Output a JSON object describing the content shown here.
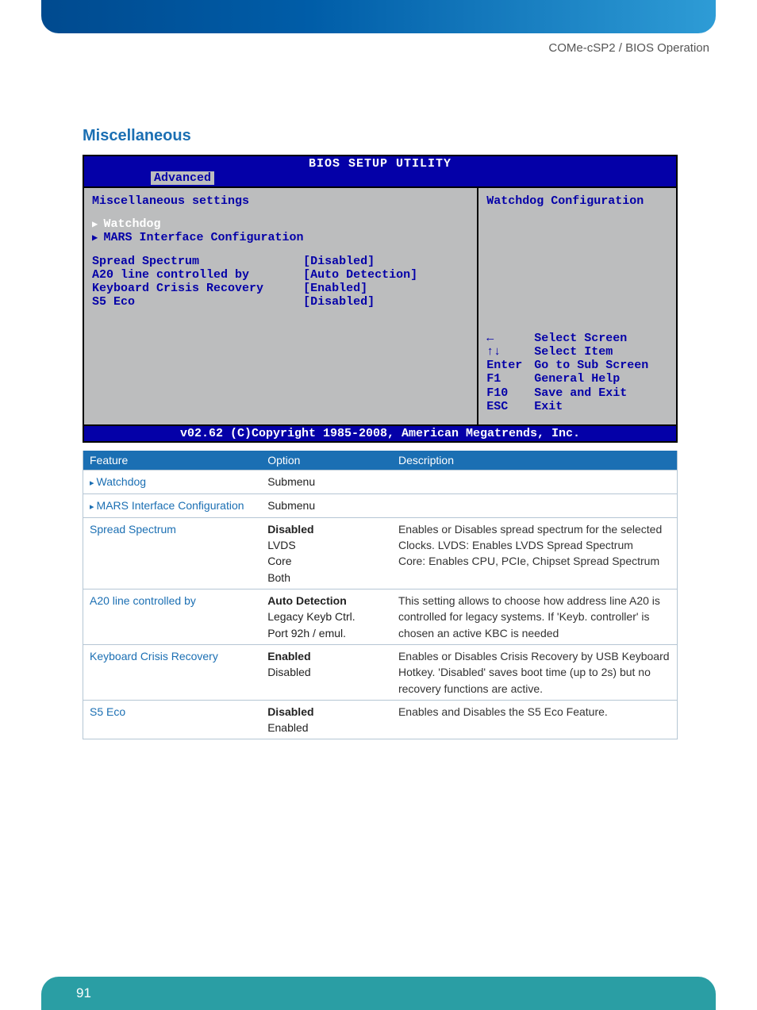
{
  "breadcrumb": "COMe-cSP2 / BIOS Operation",
  "section_title": "Miscellaneous",
  "bios": {
    "title": "BIOS SETUP UTILITY",
    "tab": "Advanced",
    "left_heading": "Miscellaneous settings",
    "submenus": [
      {
        "label": "Watchdog",
        "selected": true
      },
      {
        "label": "MARS Interface Configuration",
        "selected": false
      }
    ],
    "settings": [
      {
        "label": "Spread Spectrum",
        "value": "[Disabled]"
      },
      {
        "label": "A20 line controlled by",
        "value": "[Auto Detection]"
      },
      {
        "label": "Keyboard Crisis Recovery",
        "value": "[Enabled]"
      },
      {
        "label": "S5 Eco",
        "value": "[Disabled]"
      }
    ],
    "right_heading": "Watchdog Configuration",
    "help": [
      {
        "key": "←",
        "action": "Select Screen"
      },
      {
        "key": "↑↓",
        "action": "Select Item"
      },
      {
        "key": "Enter",
        "action": "Go to Sub Screen"
      },
      {
        "key": "F1",
        "action": "General Help"
      },
      {
        "key": "F10",
        "action": "Save and Exit"
      },
      {
        "key": "ESC",
        "action": "Exit"
      }
    ],
    "footer": "v02.62 (C)Copyright 1985-2008, American Megatrends, Inc."
  },
  "table": {
    "headers": {
      "feature": "Feature",
      "option": "Option",
      "description": "Description"
    },
    "rows": [
      {
        "feature": "Watchdog",
        "feature_caret": true,
        "options": [
          {
            "text": "Submenu",
            "bold": false
          }
        ],
        "description": ""
      },
      {
        "feature": "MARS Interface Configuration",
        "feature_caret": true,
        "options": [
          {
            "text": "Submenu",
            "bold": false
          }
        ],
        "description": ""
      },
      {
        "feature": "Spread Spectrum",
        "feature_caret": false,
        "options": [
          {
            "text": "Disabled",
            "bold": true
          },
          {
            "text": "LVDS",
            "bold": false
          },
          {
            "text": "Core",
            "bold": false
          },
          {
            "text": "Both",
            "bold": false
          }
        ],
        "description": "Enables or Disables spread spectrum for the selected Clocks. LVDS: Enables LVDS Spread Spectrum\nCore: Enables CPU, PCIe, Chipset Spread Spectrum"
      },
      {
        "feature": "A20 line controlled by",
        "feature_caret": false,
        "options": [
          {
            "text": "Auto Detection",
            "bold": true
          },
          {
            "text": "Legacy Keyb Ctrl.",
            "bold": false
          },
          {
            "text": "Port 92h / emul.",
            "bold": false
          }
        ],
        "description": "This setting allows to choose how address line A20 is controlled for legacy systems. If 'Keyb. controller' is chosen an active KBC is needed"
      },
      {
        "feature": "Keyboard Crisis Recovery",
        "feature_caret": false,
        "options": [
          {
            "text": "Enabled",
            "bold": true
          },
          {
            "text": "Disabled",
            "bold": false
          }
        ],
        "description": "Enables or Disables Crisis Recovery by USB Keyboard Hotkey. 'Disabled' saves boot time (up to 2s) but no recovery functions are active."
      },
      {
        "feature": "S5 Eco",
        "feature_caret": false,
        "options": [
          {
            "text": "Disabled",
            "bold": true
          },
          {
            "text": "Enabled",
            "bold": false
          }
        ],
        "description": "Enables and Disables the S5 Eco Feature."
      }
    ]
  },
  "page_number": "91"
}
